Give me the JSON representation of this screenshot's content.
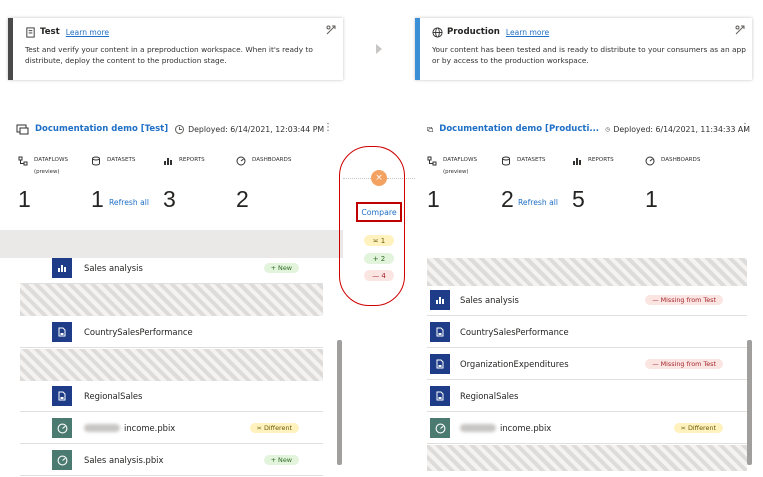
{
  "stages": {
    "test": {
      "title": "Test",
      "link": "Learn more",
      "description": "Test and verify your content in a preproduction workspace. When it's ready to distribute, deploy the content to the production stage."
    },
    "production": {
      "title": "Production",
      "link": "Learn more",
      "description": "Your content has been tested and is ready to distribute to your consumers as an app or by access to the production workspace."
    }
  },
  "test_panel": {
    "workspace": "Documentation demo [Test]",
    "deployed": "Deployed: 6/14/2021, 12:03:44 PM",
    "more": "⋮",
    "metrics": {
      "dataflows": {
        "label": "DATAFLOWS",
        "sub": "(preview)",
        "value": "1"
      },
      "datasets": {
        "label": "DATASETS",
        "value": "1",
        "action": "Refresh all"
      },
      "reports": {
        "label": "REPORTS",
        "value": "3"
      },
      "dashboards": {
        "label": "DASHBOARDS",
        "value": "2"
      }
    },
    "rows": [
      {
        "name": "Sales analysis",
        "badge": "+ New"
      },
      {
        "name": "CountrySalesPerformance"
      },
      {
        "name": "RegionalSales"
      },
      {
        "name": "income.pbix",
        "badge": "≍ Different"
      },
      {
        "name": "Sales analysis.pbix",
        "badge": "+ New"
      }
    ]
  },
  "prod_panel": {
    "workspace": "Documentation demo [Producti...",
    "deployed": "Deployed: 6/14/2021, 11:34:33 AM",
    "more": "⋮",
    "metrics": {
      "dataflows": {
        "label": "DATAFLOWS",
        "sub": "(preview)",
        "value": "1"
      },
      "datasets": {
        "label": "DATASETS",
        "value": "2",
        "action": "Refresh all"
      },
      "reports": {
        "label": "REPORTS",
        "value": "5"
      },
      "dashboards": {
        "label": "DASHBOARDS",
        "value": "1"
      }
    },
    "rows": [
      {
        "name": "Sales analysis",
        "badge": "— Missing from Test"
      },
      {
        "name": "CountrySalesPerformance"
      },
      {
        "name": "OrganizationExpenditures",
        "badge": "— Missing from Test"
      },
      {
        "name": "RegionalSales"
      },
      {
        "name": "income.pbix",
        "badge": "≍ Different"
      }
    ]
  },
  "compare": {
    "icon": "×",
    "button": "Compare",
    "different": "≍ 1",
    "added": "+ 2",
    "removed": "— 4"
  }
}
